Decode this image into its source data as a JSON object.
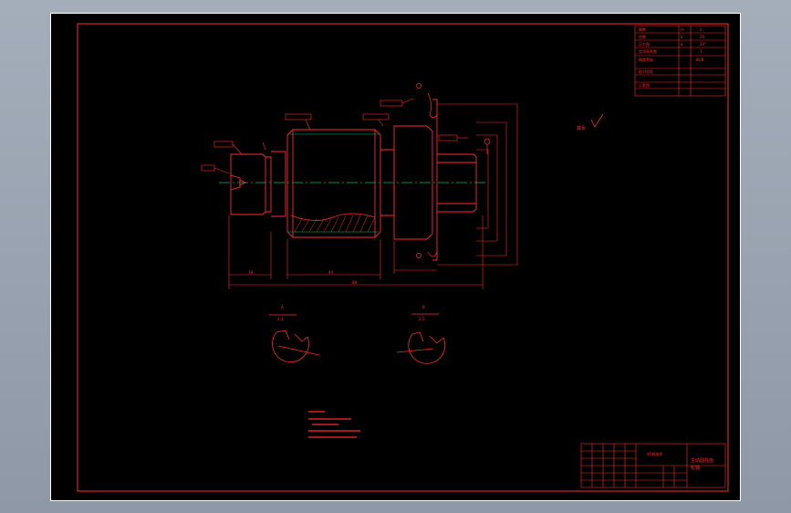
{
  "colors": {
    "background": "#000000",
    "outer_frame": "#ffffff",
    "linework": "#ff2a2a",
    "centerline": "#00c060",
    "hatch": "#ff2a2a",
    "desktop": "#9aa4b1"
  },
  "drawing": {
    "dimensions": {
      "overall_length": "88",
      "mid_length": "44",
      "left_length": "18"
    },
    "section_a_label": "A",
    "section_a_scale": "2:1",
    "section_b_label": "B",
    "section_b_scale": "2:1",
    "roughness_note": "其余"
  },
  "title_block": {
    "part_name": "主动圆柱齿",
    "part_name_line2": "轮轴",
    "material": "45钢调质"
  },
  "icons": [
    "roughness-symbol-icon",
    "datum-symbol-icon"
  ]
}
